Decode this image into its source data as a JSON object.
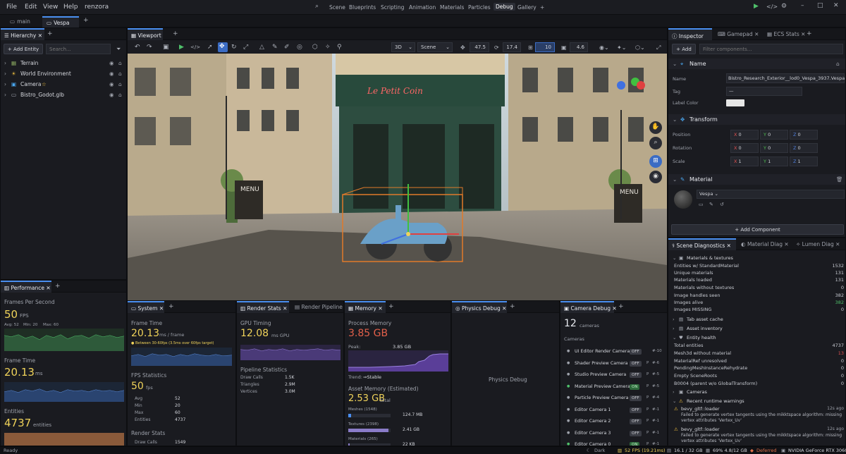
{
  "app": {
    "name": "renzora"
  },
  "menus": [
    "File",
    "Edit",
    "View",
    "Help",
    "renzora"
  ],
  "layout_tabs": [
    "Scene",
    "Blueprints",
    "Scripting",
    "Animation",
    "Materials",
    "Particles",
    "Debug",
    "Gallery"
  ],
  "layout_add": "+",
  "document_tabs": [
    {
      "label": "main"
    },
    {
      "label": "Vespa"
    }
  ],
  "hierarchy": {
    "tab": "Hierarchy",
    "add_entity": "Add Entity",
    "search_placeholder": "Search...",
    "items": [
      "Terrain",
      "World Environment",
      "Camera",
      "Bistro_Godot.glb"
    ]
  },
  "viewport": {
    "tab": "Viewport",
    "mode": "3D",
    "scene_sel": "Scene",
    "v1": "47.5",
    "v2": "17.4",
    "v3": "10",
    "v4": "4.6"
  },
  "inspector": {
    "tabs": [
      "Inspector",
      "Gamepad",
      "ECS Stats"
    ],
    "add": "Add",
    "filter_placeholder": "Filter components...",
    "name_section": "Name",
    "name_label": "Name",
    "name_value": "Bistro_Research_Exterior__lod0_Vespa_3937.Vespa",
    "tag_label": "Tag",
    "tag_value": "—",
    "label_color": "Label Color",
    "transform": "Transform",
    "rows": [
      {
        "label": "Position",
        "x": "0",
        "y": "0",
        "z": "0"
      },
      {
        "label": "Rotation",
        "x": "0",
        "y": "0",
        "z": "0"
      },
      {
        "label": "Scale",
        "x": "1",
        "y": "1",
        "z": "1"
      }
    ],
    "axis_x": "X",
    "axis_y": "Y",
    "axis_z": "Z",
    "material": "Material",
    "material_name": "Vespa",
    "add_component": "Add Component"
  },
  "diagnostics": {
    "tabs": [
      "Scene Diagnostics",
      "Material Diag",
      "Lumen Diag"
    ],
    "mat_title": "Materials & textures",
    "mat_rows": [
      [
        "Entities w/ StandardMaterial",
        "1532"
      ],
      [
        "Unique materials",
        "131"
      ],
      [
        "Materials loaded",
        "131"
      ],
      [
        "Materials without textures",
        "0"
      ]
    ],
    "img_rows": [
      [
        "Image handles seen",
        "382"
      ],
      [
        "Images alive",
        "382"
      ],
      [
        "Images MISSING",
        "0"
      ]
    ],
    "tab_asset": "Tab asset cache",
    "asset_inv": "Asset inventory",
    "entity_health": "Entity health",
    "eh_rows": [
      [
        "Total entities",
        "4737"
      ],
      [
        "Mesh3d without material",
        "13"
      ],
      [
        "MaterialRef unresolved",
        "0"
      ],
      [
        "PendingMeshInstanceRehydrate",
        "0"
      ],
      [
        "Empty SceneRoots",
        "0"
      ],
      [
        "B0004 (parent w/o GlobalTransform)",
        "0"
      ]
    ],
    "cameras": "Cameras",
    "warnings_title": "Recent runtime warnings",
    "warnings": [
      {
        "src": "bevy_gltf::loader",
        "time": "12s ago",
        "msg1": "Failed to generate vertex tangents using the mikktspace algorithm: missing",
        "msg2": "vertex attributes 'Vertex_Uv'"
      },
      {
        "src": "bevy_gltf::loader",
        "time": "12s ago",
        "msg1": "Failed to generate vertex tangents using the mikktspace algorithm: missing",
        "msg2": "vertex attributes 'Vertex_Uv'"
      }
    ]
  },
  "performance": {
    "tab": "Performance",
    "fps_label": "Frames Per Second",
    "fps": "50",
    "fps_unit": "FPS",
    "avg": "Avg: 52",
    "min": "Min: 20",
    "max": "Max: 60",
    "ft_label": "Frame Time",
    "ft": "20.13",
    "ft_unit": "ms",
    "ent_label": "Entities",
    "ent": "4737",
    "ent_unit": "entities"
  },
  "system": {
    "tab": "System",
    "ft_label": "Frame Time",
    "ft": "20.13",
    "ft_unit": "ms / frame",
    "ft_note": "Between 30-60fps (3.5ms over 60fps target)",
    "fps_label": "FPS Statistics",
    "fps": "50",
    "fps_unit": "fps",
    "stats": [
      [
        "Avg",
        "52"
      ],
      [
        "Min",
        "20"
      ],
      [
        "Max",
        "60"
      ],
      [
        "Entities",
        "4737"
      ]
    ],
    "rs_label": "Render Stats",
    "rs_rows": [
      [
        "Draw Calls",
        "1549"
      ]
    ]
  },
  "render_stats": {
    "tabs": [
      "Render Stats",
      "Render Pipeline"
    ],
    "gpu_label": "GPU Timing",
    "gpu": "12.08",
    "gpu_unit": "ms GPU",
    "pipe_label": "Pipeline Statistics",
    "rows": [
      [
        "Draw Calls",
        "1.5K"
      ],
      [
        "Triangles",
        "2.9M"
      ],
      [
        "Vertices",
        "3.0M"
      ]
    ]
  },
  "memory": {
    "tab": "Memory",
    "proc_label": "Process Memory",
    "proc": "3.85 GB",
    "peak_label": "Peak:",
    "peak": "3.85 GB",
    "trend": "Trend:",
    "trend_val": "⇒Stable",
    "asset_label": "Asset Memory (Estimated)",
    "asset": "2.53 GB",
    "asset_unit": "total",
    "bars": [
      {
        "label": "Meshes (1548)",
        "value": "124.7 MB",
        "fill": 0.06
      },
      {
        "label": "Textures (2398)",
        "value": "2.41 GB",
        "fill": 0.95
      },
      {
        "label": "Materials (265)",
        "value": "22 KB",
        "fill": 0.01
      }
    ]
  },
  "physics": {
    "tab": "Physics Debug",
    "body": "Physics Debug"
  },
  "camera_debug": {
    "tab": "Camera Debug",
    "count": "12",
    "count_unit": "cameras",
    "cam_label": "Cameras",
    "items": [
      {
        "name": "UI Editor Render Camera",
        "badge": "OFF",
        "p": "",
        "num": "#-10",
        "on": false
      },
      {
        "name": "Shader Preview Camera",
        "badge": "OFF",
        "p": "P",
        "num": "#-6",
        "on": false
      },
      {
        "name": "Studio Preview Camera",
        "badge": "OFF",
        "p": "P",
        "num": "#-5",
        "on": false
      },
      {
        "name": "Material Preview Camera",
        "badge": "ON",
        "p": "P",
        "num": "#-5",
        "on": true
      },
      {
        "name": "Particle Preview Camera",
        "badge": "OFF",
        "p": "P",
        "num": "#-4",
        "on": false
      },
      {
        "name": "Editor Camera 1",
        "badge": "OFF",
        "p": "P",
        "num": "#-1",
        "on": false
      },
      {
        "name": "Editor Camera 2",
        "badge": "OFF",
        "p": "P",
        "num": "#-1",
        "on": false
      },
      {
        "name": "Editor Camera 3",
        "badge": "OFF",
        "p": "P",
        "num": "#-1",
        "on": false
      },
      {
        "name": "Editor Camera 0",
        "badge": "ON",
        "p": "P",
        "num": "#-1",
        "on": true
      }
    ]
  },
  "statusbar": {
    "ready": "Ready",
    "theme": "Dark",
    "fps": "52 FPS (19.21ms)",
    "ram": "16.1 / 32 GB",
    "vram": "69% 4.8/12 GB",
    "deferred": "Deferred",
    "gpu": "NVIDIA GeForce RTX 3060"
  },
  "scene_text": {
    "sign": "Le Petit Coin",
    "menu": "MENU"
  },
  "colors": {
    "accent": "#4a8ff0",
    "highlight": "#f0d35a",
    "axis_x": "#e05050",
    "axis_y": "#50c050",
    "axis_z": "#5080e0"
  }
}
